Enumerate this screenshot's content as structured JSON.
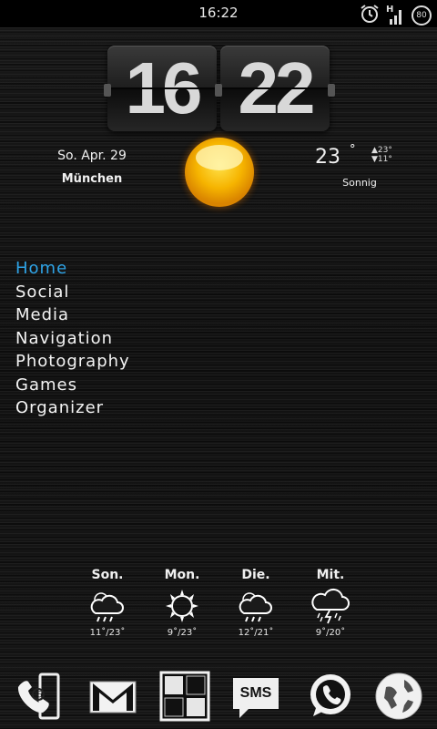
{
  "status_bar": {
    "time": "16:22",
    "network": "H",
    "battery": "80",
    "icons": [
      "alarm-icon",
      "signal-icon",
      "battery-icon"
    ]
  },
  "clock": {
    "hours": "16",
    "minutes": "22"
  },
  "weather_now": {
    "date": "So. Apr. 29",
    "city": "München",
    "temperature": "23",
    "degree": "°",
    "high": "▲23°",
    "low": "▼11°",
    "condition": "Sonnig",
    "icon": "sun-icon"
  },
  "menu": {
    "items": [
      {
        "label": "Home",
        "active": true
      },
      {
        "label": "Social"
      },
      {
        "label": "Media"
      },
      {
        "label": "Navigation"
      },
      {
        "label": "Photography"
      },
      {
        "label": "Games"
      },
      {
        "label": "Organizer"
      }
    ]
  },
  "forecast": {
    "days": [
      {
        "day": "Son.",
        "temps": "11˚/23˚",
        "icon": "rain-cloud-icon"
      },
      {
        "day": "Mon.",
        "temps": "9˚/23˚",
        "icon": "sun-icon"
      },
      {
        "day": "Die.",
        "temps": "12˚/21˚",
        "icon": "rain-cloud-icon"
      },
      {
        "day": "Mit.",
        "temps": "9˚/20˚",
        "icon": "thunderstorm-icon"
      }
    ]
  },
  "dock": {
    "apps": [
      {
        "name": "phone-contacts",
        "icon": "phone-at-icon"
      },
      {
        "name": "gmail",
        "icon": "gmail-icon"
      },
      {
        "name": "app-drawer",
        "icon": "grid-icon"
      },
      {
        "name": "sms",
        "label": "SMS",
        "icon": "sms-icon"
      },
      {
        "name": "whatsapp",
        "icon": "whatsapp-icon"
      },
      {
        "name": "browser",
        "icon": "browser-globe-icon"
      }
    ]
  },
  "colors": {
    "accent": "#2ea3e6",
    "sun": "#f5b800",
    "text": "#f0f0f0"
  }
}
